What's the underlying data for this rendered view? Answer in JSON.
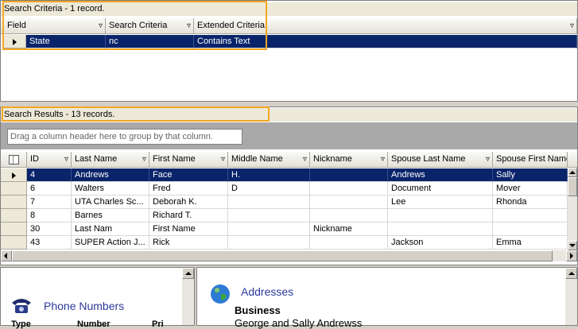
{
  "criteria": {
    "caption": "Search Criteria - 1 record.",
    "columns": [
      "Field",
      "Search Criteria",
      "Extended Criteria"
    ],
    "row": {
      "field": "State",
      "search": "nc",
      "extended": "Contains Text"
    }
  },
  "results": {
    "caption": "Search Results - 13 records.",
    "group_hint": "Drag a column header here to group by that column.",
    "columns": [
      "ID",
      "Last Name",
      "First Name",
      "Middle Name",
      "Nickname",
      "Spouse Last Name",
      "Spouse First Name"
    ],
    "rows": [
      {
        "id": "4",
        "last": "Andrews",
        "first": "Face",
        "middle": "H.",
        "nick": "",
        "slast": "Andrews",
        "sfirst": "Sally"
      },
      {
        "id": "6",
        "last": "Walters",
        "first": "Fred",
        "middle": "D",
        "nick": "",
        "slast": "Document",
        "sfirst": "Mover"
      },
      {
        "id": "7",
        "last": "UTA Charles Sc...",
        "first": "Deborah K.",
        "middle": "",
        "nick": "",
        "slast": "Lee",
        "sfirst": "Rhonda"
      },
      {
        "id": "8",
        "last": "Barnes",
        "first": "Richard T.",
        "middle": "",
        "nick": "",
        "slast": "",
        "sfirst": ""
      },
      {
        "id": "30",
        "last": "Last Nam",
        "first": "First Name",
        "middle": "",
        "nick": "Nickname",
        "slast": "",
        "sfirst": ""
      },
      {
        "id": "43",
        "last": "SUPER Action J...",
        "first": "Rick",
        "middle": "",
        "nick": "",
        "slast": "Jackson",
        "sfirst": "Emma"
      }
    ]
  },
  "phone": {
    "title": "Phone Numbers",
    "col_type": "Type",
    "col_number": "Number",
    "col_pri": "Pri"
  },
  "addresses": {
    "title": "Addresses",
    "section": "Business",
    "line1": "George and Sally Andrewss"
  },
  "colors": {
    "selection": "#0a246a",
    "highlight_border": "#f5a623",
    "title_blue": "#2b3a9a"
  }
}
